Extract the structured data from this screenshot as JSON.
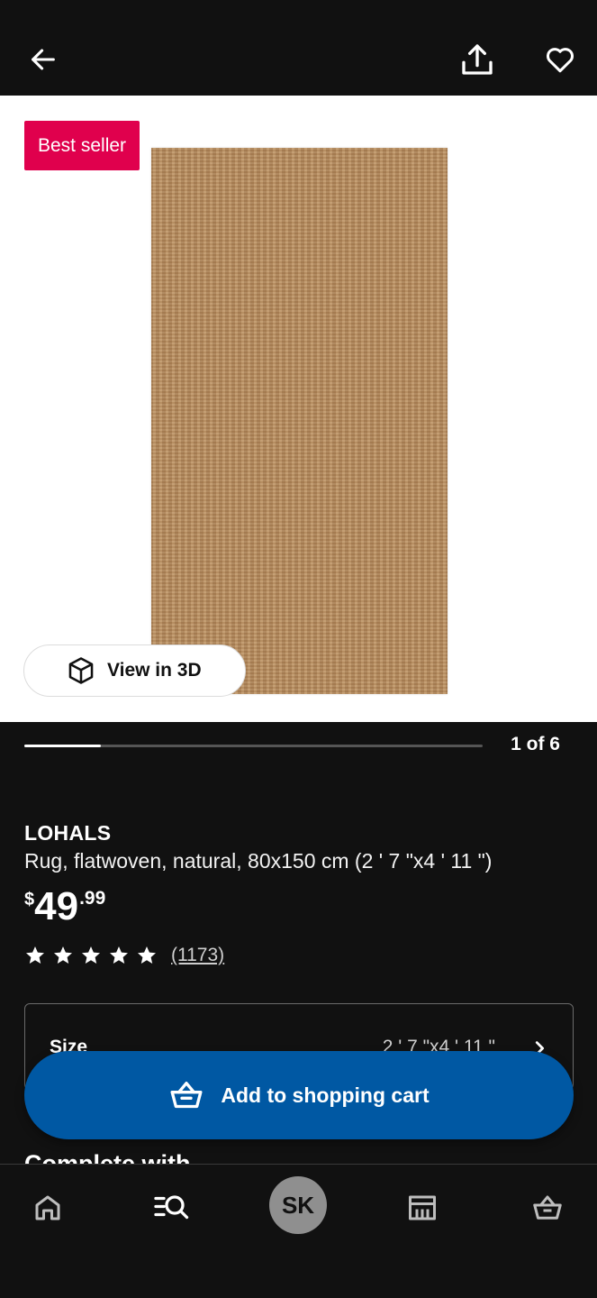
{
  "header": {
    "back_icon": "arrow-left-icon",
    "share_icon": "share-upload-icon",
    "favourite_icon": "heart-outline-icon"
  },
  "gallery": {
    "badge": "Best seller",
    "view_3d_label": "View in 3D",
    "view_3d_icon": "cube-3d-icon",
    "counter": "1 of 6",
    "progress_fraction": 0.167
  },
  "product": {
    "name": "LOHALS",
    "description": "Rug, flatwoven, natural, 80x150 cm (2 ' 7 \"x4 ' 11 \")",
    "price": {
      "currency": "$",
      "integer": "49",
      "decimal": ".99"
    },
    "rating": {
      "stars": 5,
      "review_count": "(1173)"
    }
  },
  "size": {
    "label": "Size",
    "value": "2 ' 7 \"x4 ' 11 \""
  },
  "section_peek": "Complete with",
  "cart_button": {
    "label": "Add to shopping cart",
    "icon": "shopping-basket-icon"
  },
  "bottom_nav": {
    "profile_initials": "SK",
    "items": [
      "home-icon",
      "search-list-icon",
      "profile-avatar",
      "store-icon",
      "basket-icon"
    ]
  },
  "colors": {
    "background": "#111111",
    "badge": "#e0004d",
    "primary_button": "#0058a3"
  }
}
